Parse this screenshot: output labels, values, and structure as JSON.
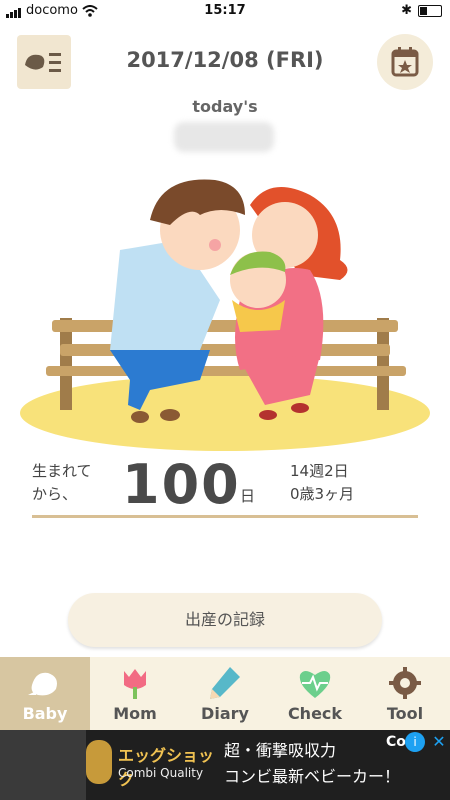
{
  "status": {
    "carrier": "docomo",
    "time": "15:17"
  },
  "header": {
    "date": "2017/12/08 (FRI)",
    "subtitle": "today's"
  },
  "age": {
    "left": "生まれて\nから、",
    "number": "100",
    "unit": "日",
    "right_1": "14週2日",
    "right_2": "0歳3ヶ月"
  },
  "button": {
    "label": "出産の記録"
  },
  "tabs": [
    {
      "label": "Baby",
      "icon": "bird-icon",
      "active": true
    },
    {
      "label": "Mom",
      "icon": "tulip-icon",
      "active": false
    },
    {
      "label": "Diary",
      "icon": "pencil-icon",
      "active": false
    },
    {
      "label": "Check",
      "icon": "heart-pulse-icon",
      "active": false
    },
    {
      "label": "Tool",
      "icon": "gear-icon",
      "active": false
    }
  ],
  "ad": {
    "brand_jp": "エッグショック",
    "brand_en": "Combi Quality",
    "copy_1": "超・衝撃吸収力",
    "copy_2": "コンビ最新ベビーカー！",
    "corner": "Co"
  },
  "colors": {
    "accent": "#d7c6a1",
    "tabbar": "#f8f2e1",
    "line": "#d8bf94"
  }
}
